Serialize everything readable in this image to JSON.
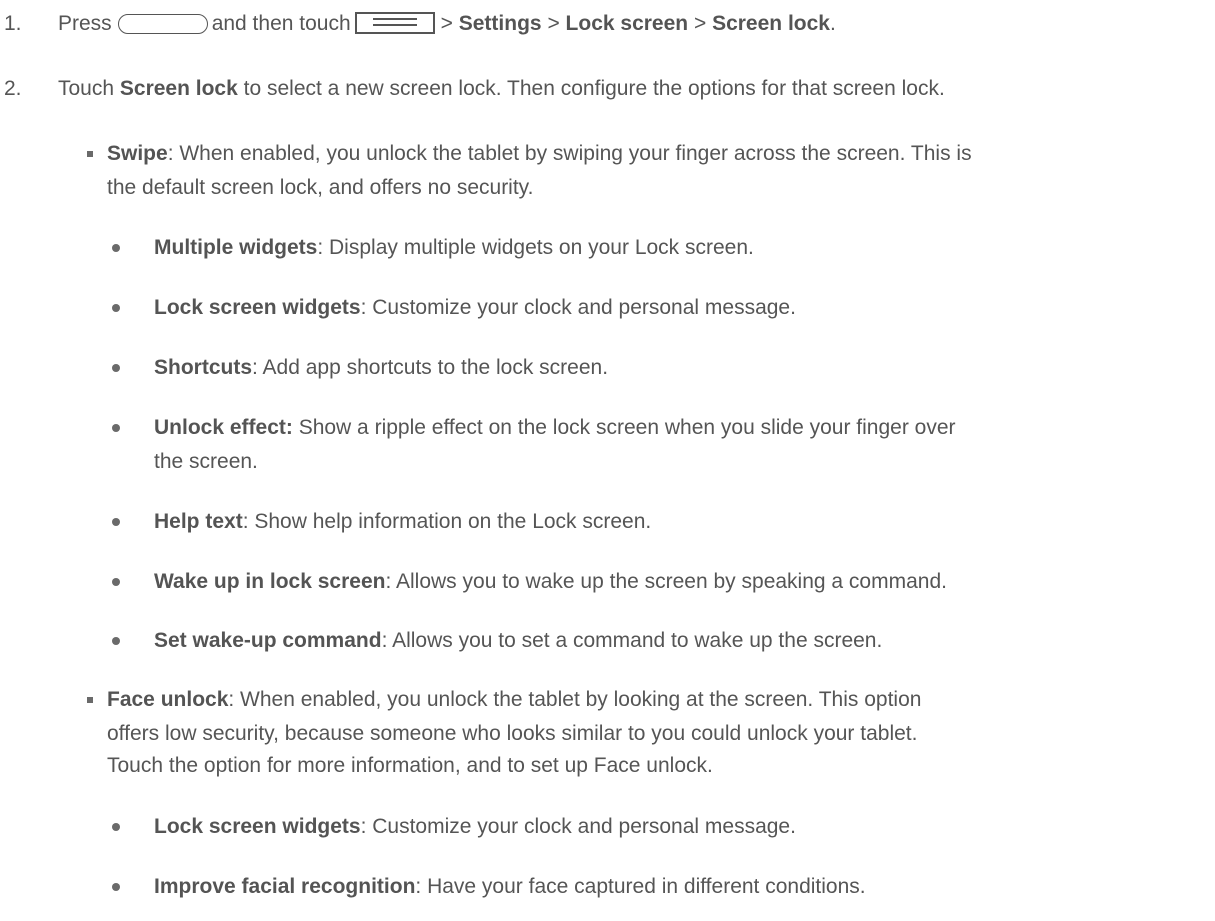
{
  "step1": {
    "num": "1.",
    "press": "Press",
    "then": "and then touch",
    "sep1": ">",
    "settings": "Settings",
    "sep2": ">",
    "lock_screen": "Lock screen",
    "sep3": ">",
    "screen_lock": "Screen lock",
    "end": "."
  },
  "step2": {
    "num": "2.",
    "touch": "Touch",
    "bold": "Screen lock",
    "rest": "to select a new screen lock. Then configure the options for that screen lock."
  },
  "swipe": {
    "term": "Swipe",
    "line1": ": When enabled, you unlock the tablet by swiping your finger across the screen. This is",
    "line2": "the default screen lock, and offers no security."
  },
  "swipe_options": [
    {
      "term": "Multiple widgets",
      "desc": ": Display multiple widgets on your Lock screen."
    },
    {
      "term": "Lock screen widgets",
      "desc": ": Customize your clock and personal message."
    },
    {
      "term": "Shortcuts",
      "desc": ": Add app shortcuts to the lock screen."
    },
    {
      "term": "Unlock effect:",
      "desc": " Show a ripple effect on the lock screen when you slide your finger over",
      "desc2": "the screen."
    },
    {
      "term": "Help text",
      "desc": ": Show help information on the Lock screen."
    },
    {
      "term": "Wake up in lock screen",
      "desc": ": Allows you to wake up the screen by speaking a command."
    },
    {
      "term": "Set wake-up command",
      "desc": ": Allows you to set a command to wake up the screen."
    }
  ],
  "face": {
    "term": "Face unlock",
    "line1": ": When enabled, you unlock the tablet by looking at the screen. This option",
    "line2": "offers low security, because someone who looks similar to you could unlock your tablet.",
    "line3": "Touch the option for more information, and to set up Face unlock."
  },
  "face_options": [
    {
      "term": "Lock screen widgets",
      "desc": ": Customize your clock and personal message."
    },
    {
      "term": "Improve facial recognition",
      "desc": ": Have your face captured in different conditions."
    }
  ],
  "icons": {
    "home_key": "home-key-icon",
    "menu_key": "menu-key-icon"
  }
}
